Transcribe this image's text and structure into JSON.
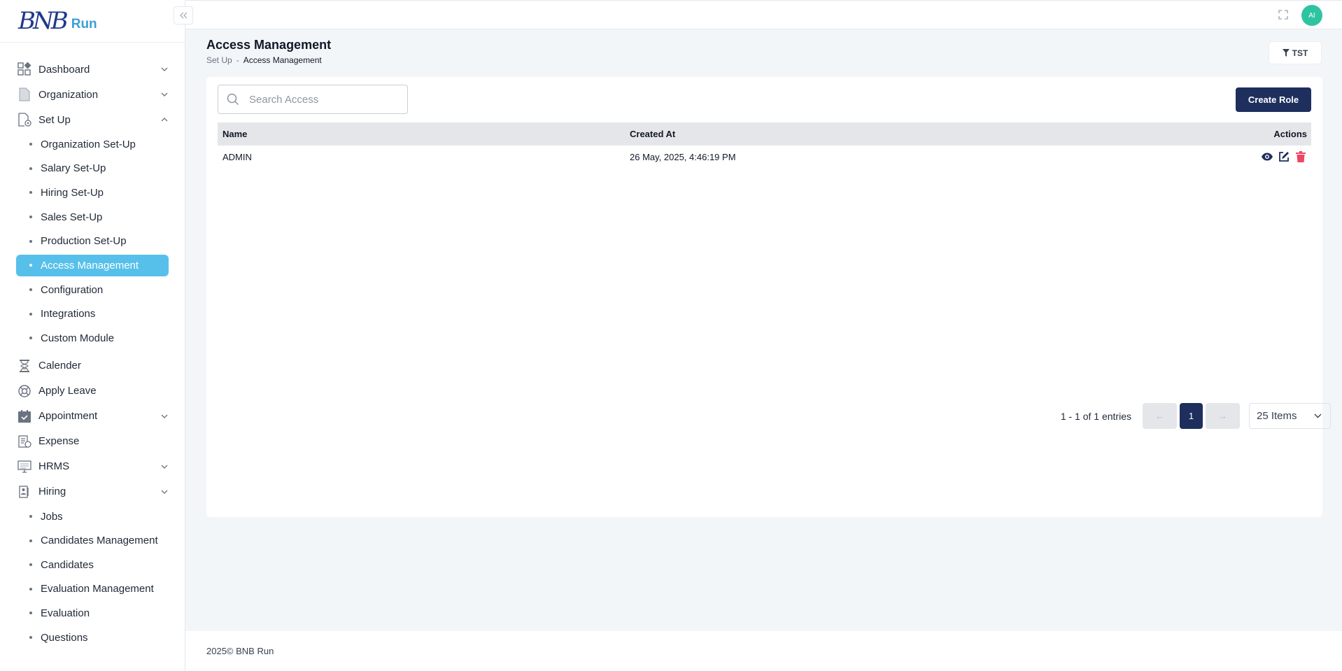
{
  "brand": {
    "logo_mark": "BNB",
    "logo_text": "Run"
  },
  "sidebar": {
    "dashboard": "Dashboard",
    "organization": "Organization",
    "setup": "Set Up",
    "setup_items": [
      "Organization Set-Up",
      "Salary Set-Up",
      "Hiring Set-Up",
      "Sales Set-Up",
      "Production Set-Up",
      "Access Management",
      "Configuration",
      "Integrations",
      "Custom Module"
    ],
    "calender": "Calender",
    "apply_leave": "Apply Leave",
    "appointment": "Appointment",
    "expense": "Expense",
    "hrms": "HRMS",
    "hiring": "Hiring",
    "hiring_items": [
      "Jobs",
      "Candidates Management",
      "Candidates",
      "Evaluation Management",
      "Evaluation",
      "Questions"
    ]
  },
  "topbar": {
    "avatar_initials": "AI"
  },
  "header": {
    "title": "Access Management",
    "breadcrumb_parent": "Set Up",
    "breadcrumb_sep": "-",
    "breadcrumb_current": "Access Management",
    "filter_label": "TST"
  },
  "toolbar": {
    "search_placeholder": "Search Access",
    "create_label": "Create Role"
  },
  "table": {
    "columns": [
      "Name",
      "Created At",
      "Actions"
    ],
    "rows": [
      {
        "name": "ADMIN",
        "created_at": "26 May, 2025, 4:46:19 PM"
      }
    ]
  },
  "pagination": {
    "entries": "1 - 1 of 1 entries",
    "prev": "←",
    "current_page": "1",
    "next": "→",
    "page_size": "25 Items"
  },
  "footer": {
    "text": "2025© BNB Run"
  },
  "colors": {
    "accent": "#56c0ea",
    "primary": "#1e2f5e",
    "danger": "#ef4565",
    "avatar": "#2fc4a1"
  }
}
